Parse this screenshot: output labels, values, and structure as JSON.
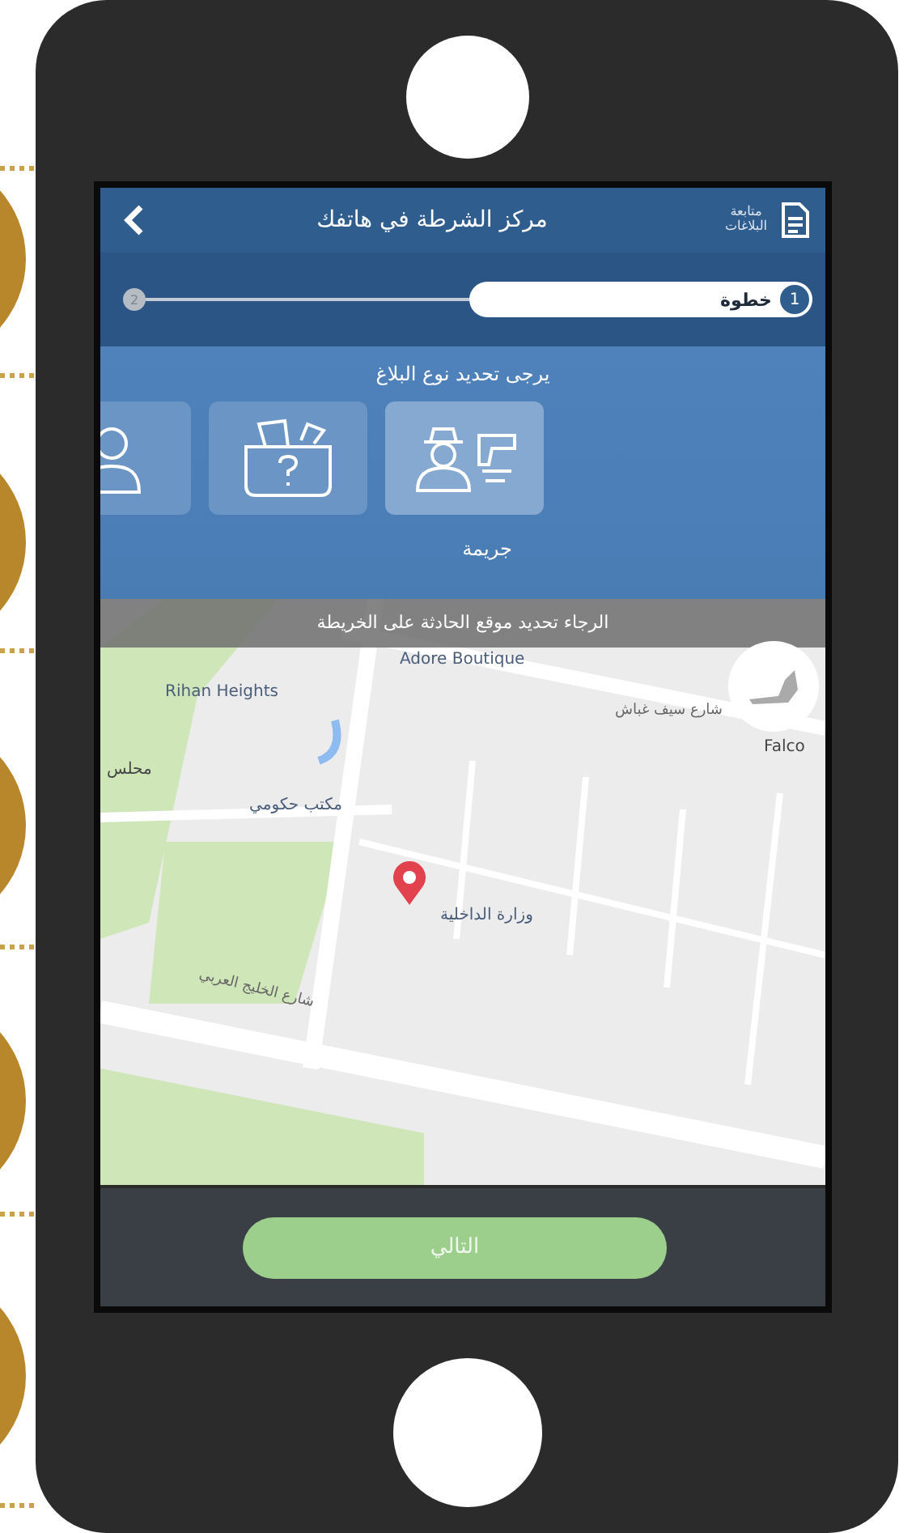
{
  "header": {
    "title": "مركز الشرطة في هاتفك",
    "reports_link": "متابعة البلاغات"
  },
  "steps": [
    {
      "number": "1",
      "label": "خطوة",
      "selected": true
    },
    {
      "number": "2",
      "selected": false
    }
  ],
  "prompt": "يرجى تحديد نوع البلاغ",
  "categories": [
    {
      "kind": "crime",
      "selected": true
    },
    {
      "kind": "lost-item",
      "selected": false
    },
    {
      "kind": "person",
      "selected": false
    }
  ],
  "selected_category_label": "جريمة",
  "map_instruction": "الرجاء تحديد موقع الحادثة على الخريطة",
  "map_labels": [
    {
      "text": "Adore Boutique",
      "kind": "poi"
    },
    {
      "text": "Rihan Heights",
      "kind": "poi"
    },
    {
      "text": "شارع سيف غباش",
      "kind": "street"
    },
    {
      "text": "Falco",
      "kind": "plain"
    },
    {
      "text": "محلس",
      "kind": "plain"
    },
    {
      "text": "مكتب حكومي",
      "kind": "poi"
    },
    {
      "text": "وزارة الداخلية",
      "kind": "poi"
    },
    {
      "text": "شارع الخليج العربي",
      "kind": "street"
    }
  ],
  "next_button": "التالي"
}
